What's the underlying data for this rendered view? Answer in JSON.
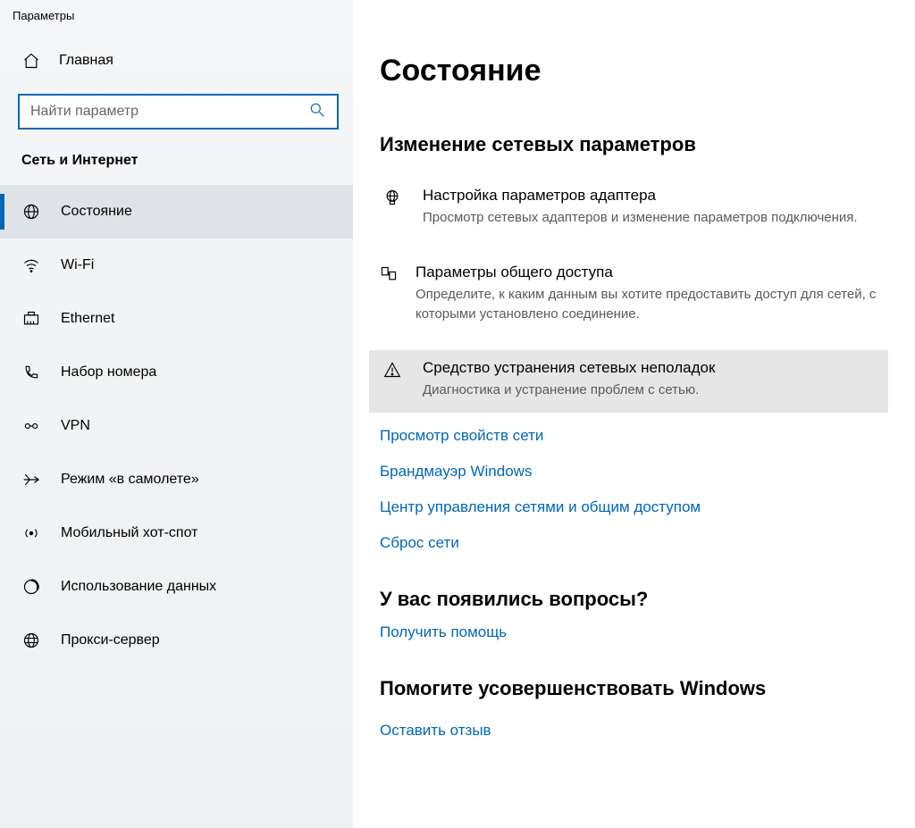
{
  "window": {
    "title": "Параметры"
  },
  "sidebar": {
    "home_label": "Главная",
    "search_placeholder": "Найти параметр",
    "category_title": "Сеть и Интернет",
    "items": [
      {
        "label": "Состояние",
        "icon": "globe",
        "selected": true
      },
      {
        "label": "Wi-Fi",
        "icon": "wifi",
        "selected": false
      },
      {
        "label": "Ethernet",
        "icon": "ethernet",
        "selected": false
      },
      {
        "label": "Набор номера",
        "icon": "dialup",
        "selected": false
      },
      {
        "label": "VPN",
        "icon": "vpn",
        "selected": false
      },
      {
        "label": "Режим «в самолете»",
        "icon": "airplane",
        "selected": false
      },
      {
        "label": "Мобильный хот-спот",
        "icon": "hotspot",
        "selected": false
      },
      {
        "label": "Использование данных",
        "icon": "datausage",
        "selected": false
      },
      {
        "label": "Прокси-сервер",
        "icon": "proxy",
        "selected": false
      }
    ]
  },
  "main": {
    "page_title": "Состояние",
    "section_title": "Изменение сетевых параметров",
    "settings": [
      {
        "icon": "adapter",
        "title": "Настройка параметров адаптера",
        "desc": "Просмотр сетевых адаптеров и изменение параметров подключения.",
        "hover": false
      },
      {
        "icon": "sharing",
        "title": "Параметры общего доступа",
        "desc": "Определите, к каким данным вы хотите предоставить доступ для сетей, с которыми установлено соединение.",
        "hover": false
      },
      {
        "icon": "troubleshoot",
        "title": "Средство устранения сетевых неполадок",
        "desc": "Диагностика и устранение проблем с сетью.",
        "hover": true
      }
    ],
    "links": [
      "Просмотр свойств сети",
      "Брандмауэр Windows",
      "Центр управления сетями и общим доступом",
      "Сброс сети"
    ],
    "questions": {
      "title": "У вас появились вопросы?",
      "link": "Получить помощь"
    },
    "improve": {
      "title": "Помогите усовершенствовать Windows",
      "link": "Оставить отзыв"
    }
  }
}
